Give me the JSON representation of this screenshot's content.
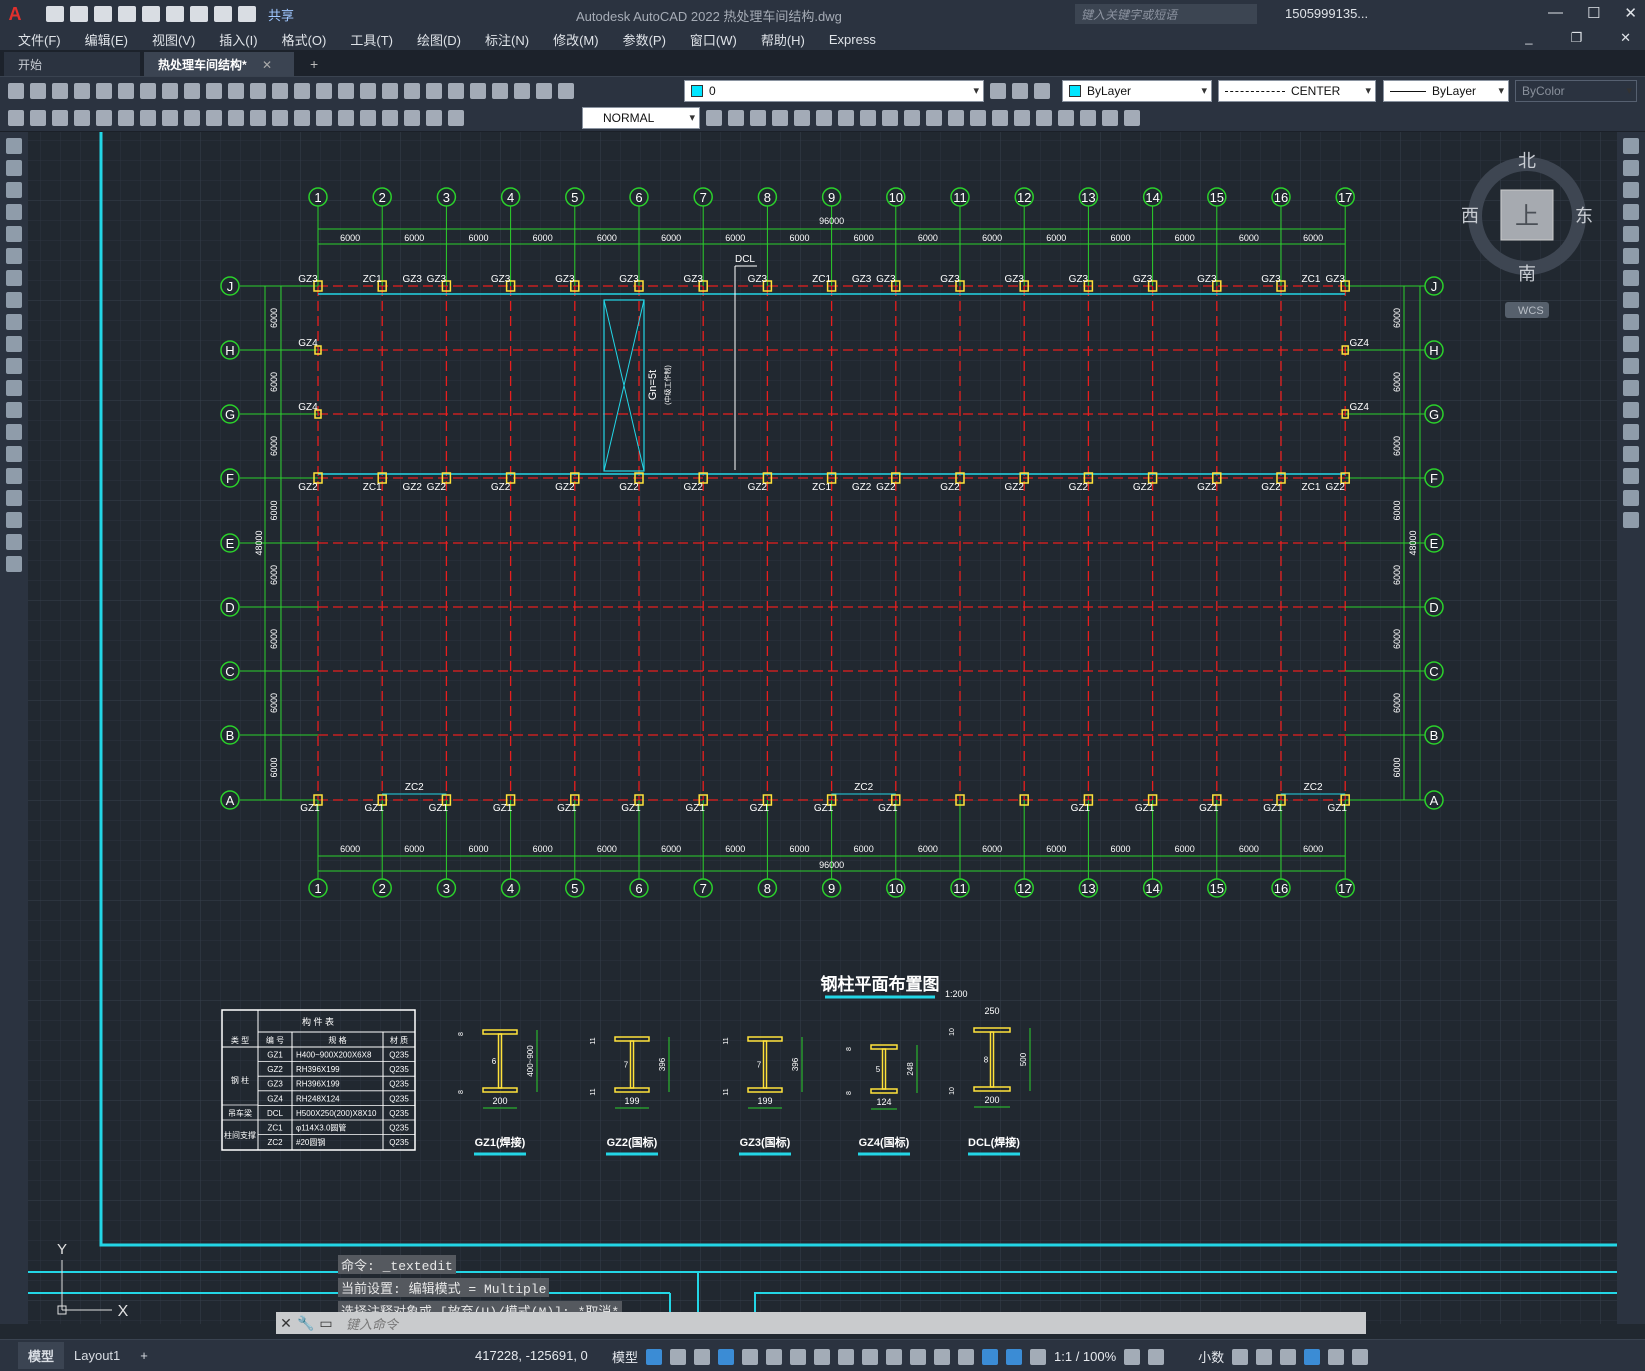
{
  "titlebar": {
    "app_logo": "A",
    "share_label": "共享",
    "title": "Autodesk AutoCAD 2022    热处理车间结构.dwg",
    "search_placeholder": "键入关键字或短语",
    "user": "1505999135...",
    "window_buttons": [
      "—",
      "☐",
      "✕"
    ]
  },
  "menu": [
    "文件(F)",
    "编辑(E)",
    "视图(V)",
    "插入(I)",
    "格式(O)",
    "工具(T)",
    "绘图(D)",
    "标注(N)",
    "修改(M)",
    "参数(P)",
    "窗口(W)",
    "帮助(H)",
    "Express"
  ],
  "tabs": {
    "start": "开始",
    "active": "热处理车间结构*"
  },
  "properties": {
    "layer": "0",
    "color": "ByLayer",
    "linetype": "CENTER",
    "lineweight": "ByLayer",
    "plotstyle": "ByColor",
    "dimstyle": "NORMAL"
  },
  "viewcube": {
    "north": "北",
    "south": "南",
    "west": "西",
    "east": "东",
    "top": "上",
    "wcs": "WCS"
  },
  "drawing": {
    "columns": [
      "1",
      "2",
      "3",
      "4",
      "5",
      "6",
      "7",
      "8",
      "9",
      "10",
      "11",
      "12",
      "13",
      "14",
      "15",
      "16",
      "17"
    ],
    "rows": [
      "J",
      "H",
      "G",
      "F",
      "E",
      "D",
      "C",
      "B",
      "A"
    ],
    "bay_span": "6000",
    "total_length": "96000",
    "total_width": "48000",
    "top_labels": [
      "GZ3",
      "GZ3",
      "ZC1",
      "GZ3",
      "GZ3",
      "GZ3",
      "GZ3",
      "GZ3",
      "GZ3",
      "GZ3",
      "ZC1",
      "GZ3",
      "GZ3",
      "GZ3",
      "GZ3",
      "GZ3",
      "GZ3",
      "ZC1",
      "GZ3",
      "GZ3"
    ],
    "dcl": "DCL",
    "crane_note": "Gn=5t",
    "crane_sub": "(中级工作制)",
    "row_f_labels": [
      "GZ2",
      "GZ2",
      "ZC1",
      "GZ2",
      "GZ2",
      "GZ2",
      "GZ2",
      "GZ2",
      "GZ2",
      "GZ2",
      "ZC1",
      "GZ2",
      "GZ2",
      "GZ2",
      "GZ2",
      "GZ2",
      "GZ2",
      "ZC1",
      "GZ2",
      "GZ2"
    ],
    "gz4": "GZ4",
    "zc2": "ZC2",
    "bottom_gz1": "GZ1",
    "plan_title": "钢柱平面布置图",
    "plan_scale": "1:200"
  },
  "member_table": {
    "title": "构 件 表",
    "headers": [
      "类 型",
      "编 号",
      "规 格",
      "材 质"
    ],
    "rows": [
      [
        "钢 柱",
        "GZ1",
        "H400~900X200X6X8",
        "Q235"
      ],
      [
        "",
        "GZ2",
        "RH396X199",
        "Q235"
      ],
      [
        "",
        "GZ3",
        "RH396X199",
        "Q235"
      ],
      [
        "",
        "GZ4",
        "RH248X124",
        "Q235"
      ],
      [
        "吊车梁",
        "DCL",
        "H500X250(200)X8X10",
        "Q235"
      ],
      [
        "柱间支撑",
        "ZC1",
        "φ114X3.0圆管",
        "Q235"
      ],
      [
        "",
        "ZC2",
        "#20圆钢",
        "Q235"
      ]
    ]
  },
  "sections": [
    {
      "name": "GZ1(焊接)",
      "width": "200",
      "height": "400~900",
      "web": "6",
      "flange": "8"
    },
    {
      "name": "GZ2(国标)",
      "width": "199",
      "height": "396",
      "web": "7",
      "flange": "11"
    },
    {
      "name": "GZ3(国标)",
      "width": "199",
      "height": "396",
      "web": "7",
      "flange": "11"
    },
    {
      "name": "GZ4(国标)",
      "width": "124",
      "height": "248",
      "web": "5",
      "flange": "8"
    },
    {
      "name": "DCL(焊接)",
      "width": "200",
      "top_width": "250",
      "height": "500",
      "web": "8",
      "flange": "10"
    }
  ],
  "ucs": {
    "x": "X",
    "y": "Y"
  },
  "command": {
    "history": [
      "命令: _textedit",
      "当前设置: 编辑模式 = Multiple",
      "选择注释对象或 [放弃(U)/模式(M)]: *取消*"
    ],
    "placeholder": "键入命令"
  },
  "status": {
    "model_tab": "模型",
    "layout_tab": "Layout1",
    "coords": "417228, -125691, 0",
    "space": "模型",
    "scale": "1:1 / 100%",
    "units": "小数"
  }
}
